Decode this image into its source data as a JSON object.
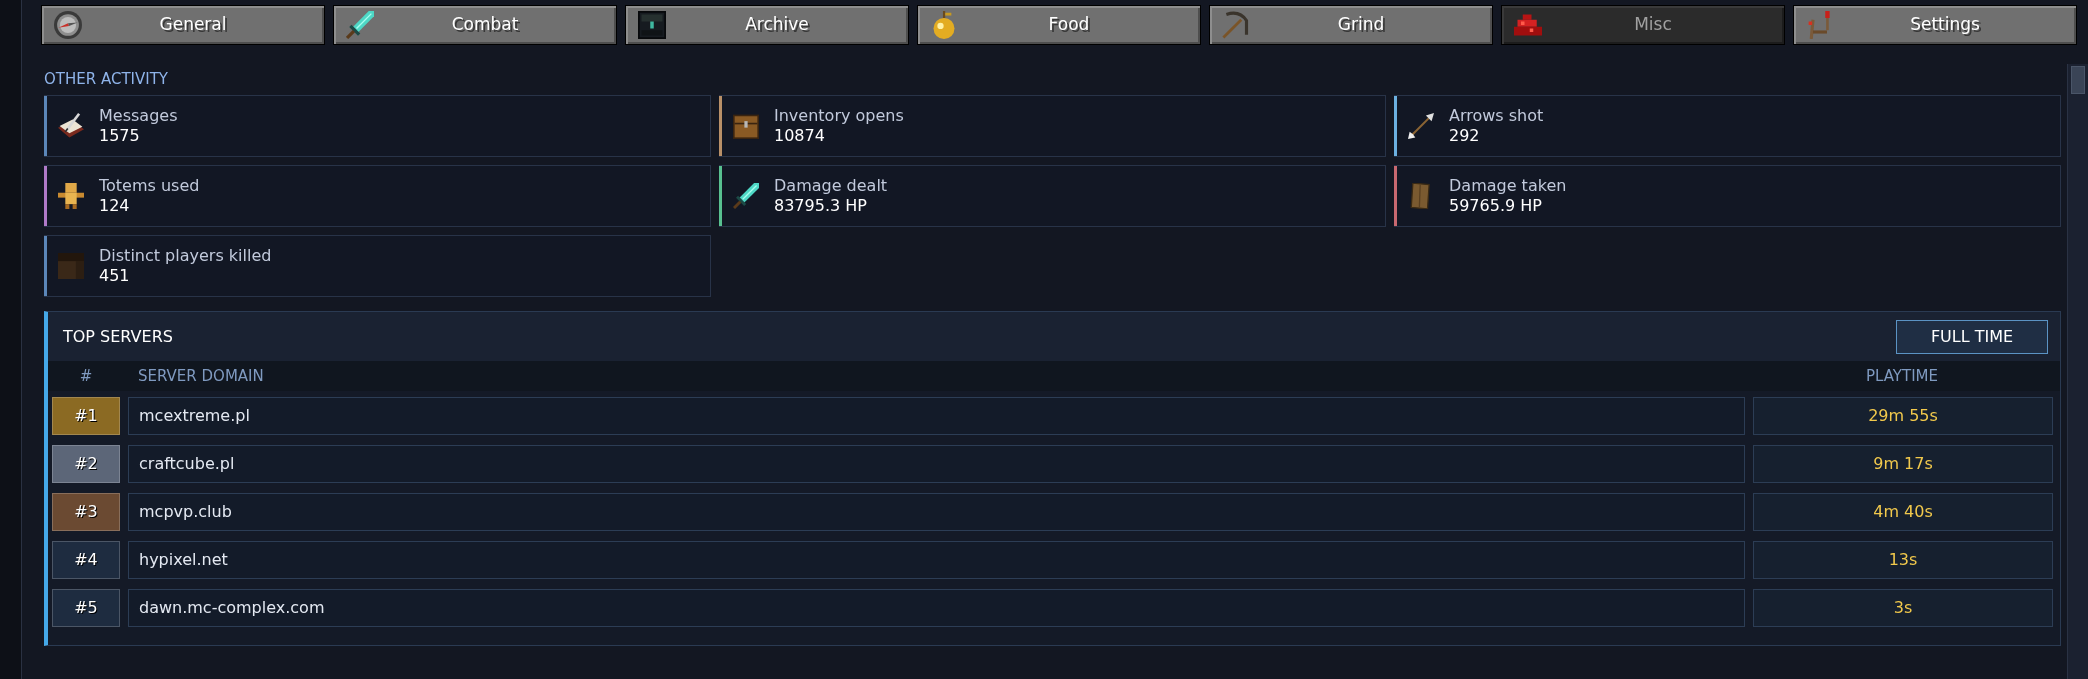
{
  "tabs": [
    {
      "label": "General",
      "selected": false
    },
    {
      "label": "Combat",
      "selected": false
    },
    {
      "label": "Archive",
      "selected": false
    },
    {
      "label": "Food",
      "selected": false
    },
    {
      "label": "Grind",
      "selected": false
    },
    {
      "label": "Misc",
      "selected": true
    },
    {
      "label": "Settings",
      "selected": false
    }
  ],
  "other_activity": {
    "title": "OTHER ACTIVITY",
    "stats": [
      {
        "label": "Messages",
        "value": "1575",
        "color": "#5b86b8"
      },
      {
        "label": "Inventory opens",
        "value": "10874",
        "color": "#b89068"
      },
      {
        "label": "Arrows shot",
        "value": "292",
        "color": "#6cb0e0"
      },
      {
        "label": "Totems used",
        "value": "124",
        "color": "#b07ac8"
      },
      {
        "label": "Damage dealt",
        "value": "83795.3 HP",
        "color": "#58c090"
      },
      {
        "label": "Damage taken",
        "value": "59765.9 HP",
        "color": "#c86870"
      },
      {
        "label": "Distinct players killed",
        "value": "451",
        "color": "#5b86b8"
      }
    ]
  },
  "top_servers": {
    "title": "TOP SERVERS",
    "button": "FULL TIME",
    "columns": [
      "#",
      "SERVER DOMAIN",
      "PLAYTIME"
    ],
    "rows": [
      {
        "rank": "#1",
        "domain": "mcextreme.pl",
        "playtime": "29m 55s",
        "color": "#8b6a23"
      },
      {
        "rank": "#2",
        "domain": "craftcube.pl",
        "playtime": "9m 17s",
        "color": "#5c6678"
      },
      {
        "rank": "#3",
        "domain": "mcpvp.club",
        "playtime": "4m 40s",
        "color": "#6b4a32"
      },
      {
        "rank": "#4",
        "domain": "hypixel.net",
        "playtime": "13s",
        "color": "#1e2c40"
      },
      {
        "rank": "#5",
        "domain": "dawn.mc-complex.com",
        "playtime": "3s",
        "color": "#1e2c40"
      }
    ]
  }
}
